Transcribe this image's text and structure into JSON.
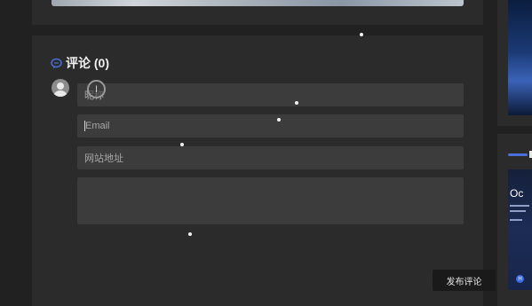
{
  "comments": {
    "title": "评论 (0)",
    "icon": "comment-bubble-icon",
    "accent_color": "#4a6fd8"
  },
  "form": {
    "nickname_placeholder": "昵称",
    "email_placeholder": "Email",
    "website_placeholder": "网站地址",
    "content_placeholder": "",
    "submit_label": "发布评论"
  },
  "sidebar": {
    "card_title_fragment": "Oc"
  },
  "cursor": {
    "type": "text-cursor-icon"
  }
}
